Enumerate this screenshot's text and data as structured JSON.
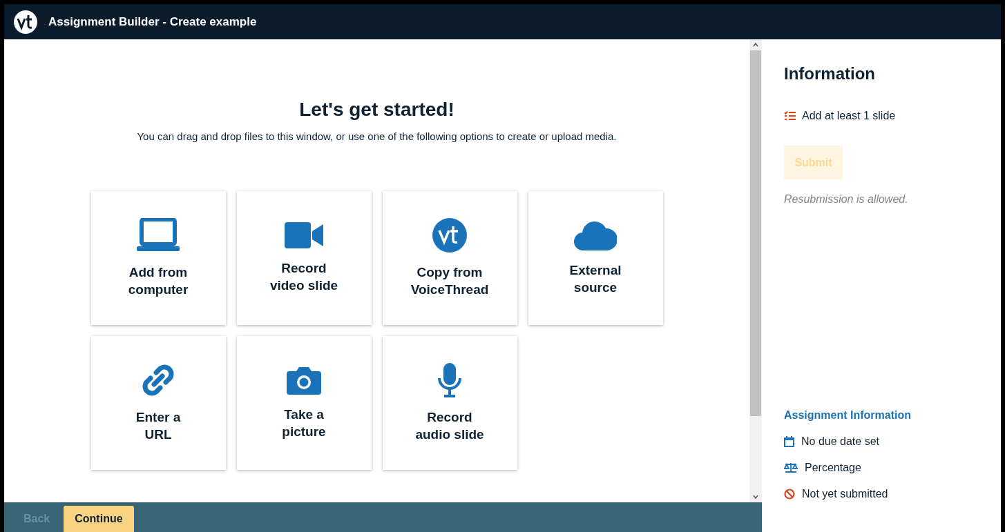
{
  "window": {
    "title": "Assignment Builder - Create example"
  },
  "main": {
    "heading": "Let's get started!",
    "subtitle": "You can drag and drop files to this window, or use one of the following options to create or upload media.",
    "options": [
      {
        "kind": "computer",
        "label": "Add from computer"
      },
      {
        "kind": "video",
        "label": "Record video slide"
      },
      {
        "kind": "voicethread",
        "label": "Copy from VoiceThread"
      },
      {
        "kind": "cloud",
        "label": "External source"
      },
      {
        "kind": "link",
        "label": "Enter a URL"
      },
      {
        "kind": "camera",
        "label": "Take a picture"
      },
      {
        "kind": "mic",
        "label": "Record audio slide"
      }
    ]
  },
  "footer": {
    "buttons": [
      {
        "label": "Back",
        "disabled": true
      },
      {
        "label": "Continue",
        "disabled": false
      }
    ]
  },
  "info": {
    "title": "Information",
    "requirement": "Add at least 1 slide",
    "submit": {
      "label": "Submit",
      "disabled": true
    },
    "note": "Resubmission is allowed.",
    "section_title": "Assignment Information",
    "items": [
      {
        "kind": "calendar",
        "text": "No due date set"
      },
      {
        "kind": "scale",
        "text": "Percentage"
      },
      {
        "kind": "blocked",
        "text": "Not yet submitted"
      }
    ]
  }
}
